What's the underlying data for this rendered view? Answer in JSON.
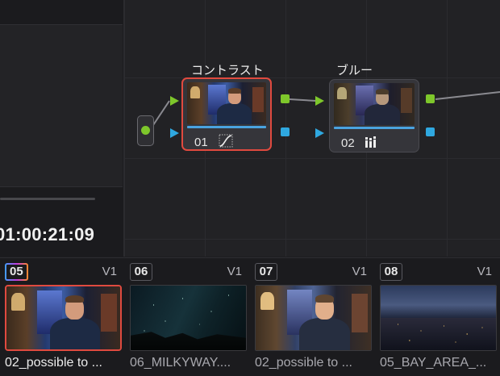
{
  "viewer": {
    "timecode": "01:00:21:09"
  },
  "nodes": [
    {
      "title": "コントラスト",
      "number": "01",
      "icon": "curves-icon",
      "selected": true
    },
    {
      "title": "ブルー",
      "number": "02",
      "icon": "rgb-mixer-icon",
      "selected": false
    }
  ],
  "clips": [
    {
      "index": "05",
      "track": "V1",
      "name": "02_possible to ...",
      "selected": true
    },
    {
      "index": "06",
      "track": "V1",
      "name": "06_MILKYWAY....",
      "selected": false
    },
    {
      "index": "07",
      "track": "V1",
      "name": "02_possible to ...",
      "selected": false
    },
    {
      "index": "08",
      "track": "V1",
      "name": "05_BAY_AREA_...",
      "selected": false
    }
  ],
  "colors": {
    "selected": "#e04a3f",
    "port_green": "#7ec72b",
    "port_blue": "#2fa8e0"
  }
}
